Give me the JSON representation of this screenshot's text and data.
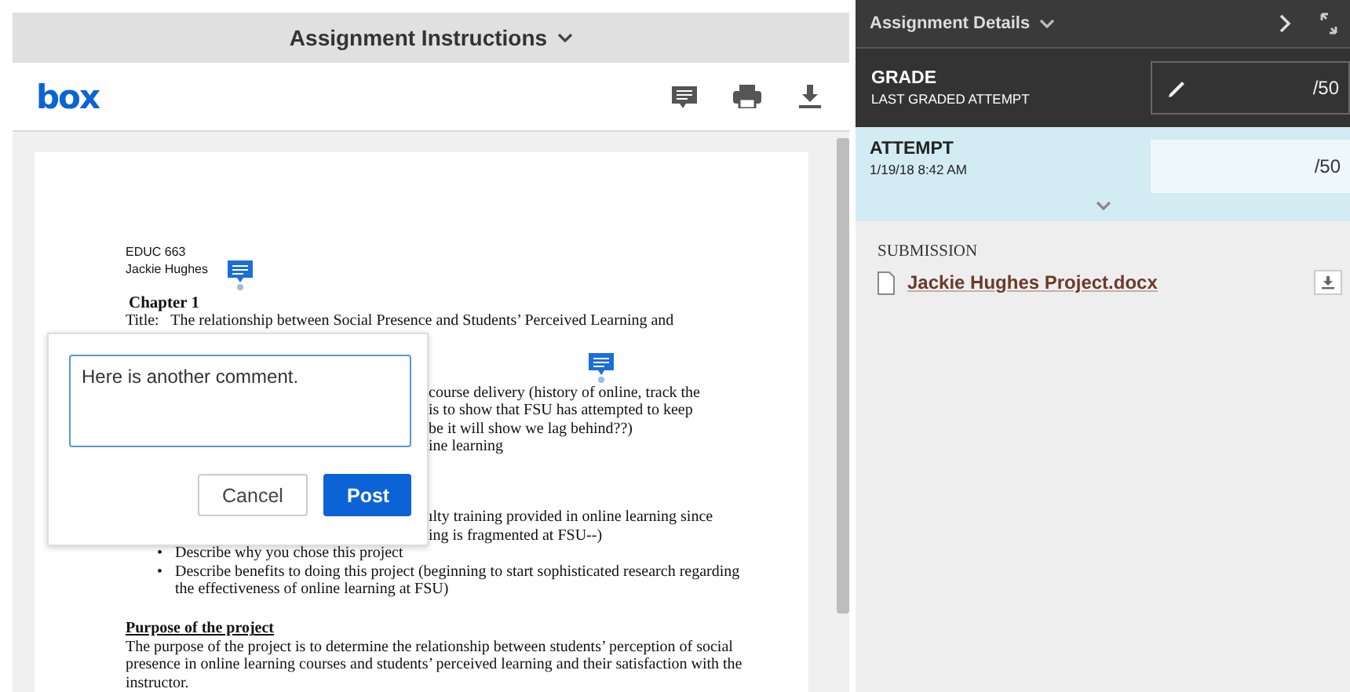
{
  "instructions": {
    "title": "Assignment Instructions",
    "logo": "box",
    "document": {
      "meta": [
        "EDUC 663",
        "Jackie Hughes"
      ],
      "chapter": "Chapter 1",
      "title_line": "Title:   The relationship between Social Presence and Students’ Perceived Learning and",
      "covered_block_1": [
        "course delivery (history of online, track the",
        "is to show that FSU has attempted to keep",
        "be it will show we lag behind??)",
        "ine learning"
      ],
      "covered_block_2": [
        "ılty training provided in online learning since",
        "ing is fragmented at FSU--)"
      ],
      "bullets": [
        {
          "marker": "•",
          "text": "Describe why you chose this project"
        },
        {
          "marker": "•",
          "text": "Describe benefits to doing this project (beginning to start sophisticated research regarding the effectiveness of online learning at FSU)"
        }
      ],
      "section_heading": "Purpose of the project",
      "paragraph": "The purpose of the project is to determine the relationship between students’ perception of social presence in online learning courses and students’ perceived learning and their satisfaction with the instructor."
    },
    "comment": {
      "value": "Here is another comment.",
      "buttons": [
        {
          "label": "Cancel",
          "kind": "secondary"
        },
        {
          "label": "Post",
          "kind": "primary"
        }
      ]
    }
  },
  "details": {
    "title": "Assignment Details",
    "grade": {
      "label": "GRADE",
      "sublabel": "LAST GRADED ATTEMPT",
      "suffix": "/50"
    },
    "attempt": {
      "label": "ATTEMPT",
      "date": "1/19/18 8:42 AM",
      "suffix": "/50"
    },
    "submission": {
      "heading": "SUBMISSION",
      "file": "Jackie Hughes Project.docx"
    }
  }
}
